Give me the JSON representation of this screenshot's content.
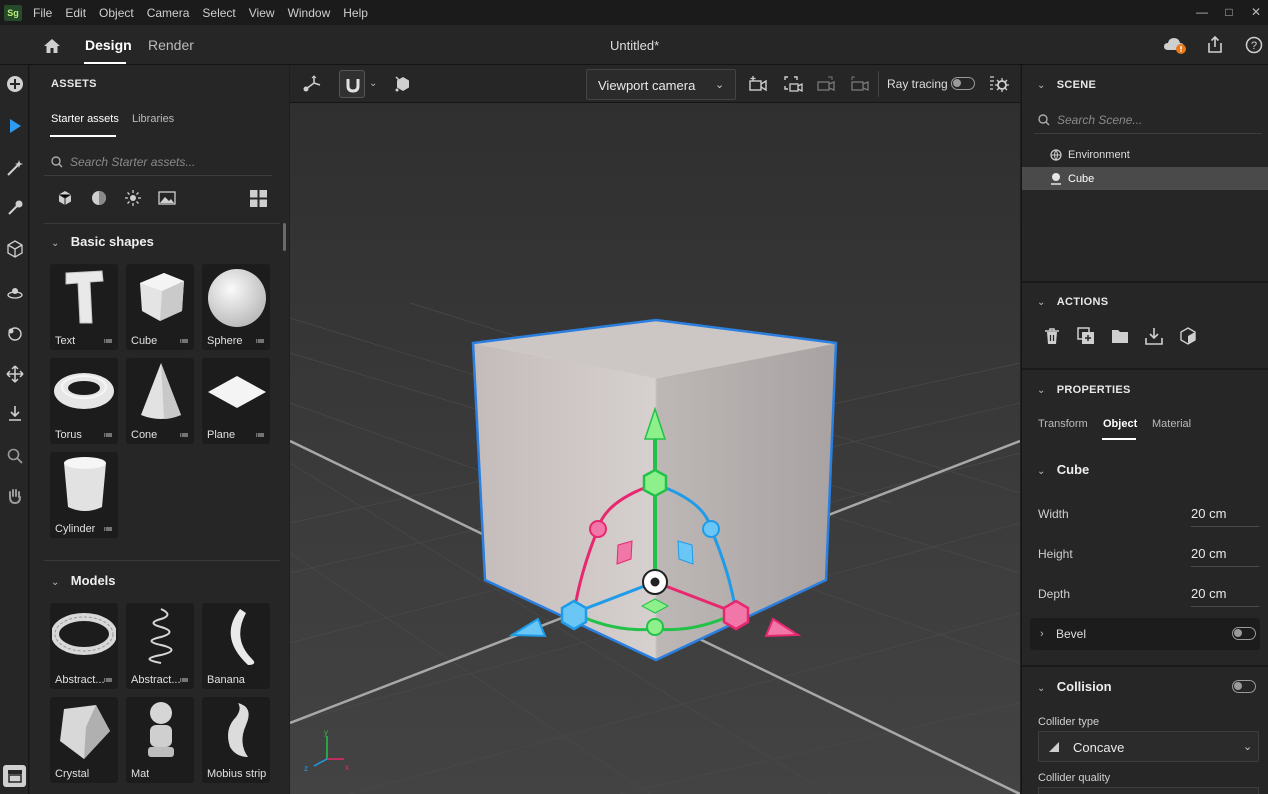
{
  "menu": {
    "logo": "Sg",
    "items": [
      "File",
      "Edit",
      "Object",
      "Camera",
      "Select",
      "View",
      "Window",
      "Help"
    ]
  },
  "titlebar": {
    "home_icon": "home-icon",
    "tabs": [
      "Design",
      "Render"
    ],
    "active_tab": "Design",
    "document_title": "Untitled*"
  },
  "assets": {
    "heading": "ASSETS",
    "tabs": [
      "Starter assets",
      "Libraries"
    ],
    "search_placeholder": "Search Starter assets...",
    "filters": [
      "model-filter-icon",
      "material-filter-icon",
      "light-filter-icon",
      "image-filter-icon"
    ],
    "groups": [
      {
        "title": "Basic shapes",
        "items": [
          "Text",
          "Cube",
          "Sphere",
          "Torus",
          "Cone",
          "Plane",
          "Cylinder"
        ]
      },
      {
        "title": "Models",
        "items": [
          "Abstract...",
          "Abstract...",
          "Banana",
          "Crystal",
          "Mat",
          "Mobius strip"
        ]
      }
    ]
  },
  "viewport_toolbar": {
    "camera_select": "Viewport camera",
    "ray_tracing_label": "Ray tracing",
    "ray_tracing_on": false
  },
  "scene": {
    "heading": "SCENE",
    "search_placeholder": "Search Scene...",
    "items": [
      {
        "label": "Environment",
        "icon": "globe-icon",
        "selected": false
      },
      {
        "label": "Cube",
        "icon": "cube-object-icon",
        "selected": true
      }
    ]
  },
  "actions": {
    "heading": "ACTIONS",
    "icons": [
      "delete-icon",
      "duplicate-icon",
      "group-icon",
      "export-icon",
      "convert-icon"
    ]
  },
  "properties": {
    "heading": "PROPERTIES",
    "tabs": [
      "Transform",
      "Object",
      "Material"
    ],
    "active_tab": "Object",
    "object_name": "Cube",
    "fields": [
      {
        "label": "Width",
        "value": "20 cm"
      },
      {
        "label": "Height",
        "value": "20 cm"
      },
      {
        "label": "Depth",
        "value": "20 cm"
      }
    ],
    "bevel_label": "Bevel",
    "bevel_on": false,
    "collision_label": "Collision",
    "collision_on": false,
    "collider_type_label": "Collider type",
    "collider_type_value": "Concave",
    "collider_quality_label": "Collider quality"
  },
  "colors": {
    "accent": "#2d9bf0",
    "x_axis": "#e8286e",
    "y_axis": "#22c24a",
    "z_axis": "#1e9ce8",
    "selection_outline": "#2a7fe0"
  }
}
